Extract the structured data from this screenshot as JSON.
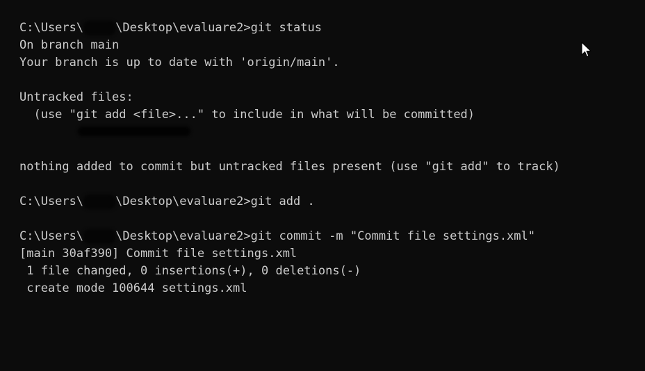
{
  "console": {
    "prompt_prefix": "C:\\Users\\",
    "prompt_suffix": "\\Desktop\\evaluare2>",
    "cmd1": "git status",
    "out1": "On branch main",
    "out2": "Your branch is up to date with 'origin/main'.",
    "out3": "Untracked files:",
    "out4": "  (use \"git add <file>...\" to include in what will be committed)",
    "out5": "nothing added to commit but untracked files present (use \"git add\" to track)",
    "cmd2": "git add .",
    "cmd3": "git commit -m \"Commit file settings.xml\"",
    "out6": "[main 30af390] Commit file settings.xml",
    "out7": " 1 file changed, 0 insertions(+), 0 deletions(-)",
    "out8": " create mode 100644 settings.xml"
  },
  "colors": {
    "background": "#0c0c0c",
    "text": "#cccccc"
  },
  "icons": {
    "cursor": "mouse-pointer-icon"
  }
}
